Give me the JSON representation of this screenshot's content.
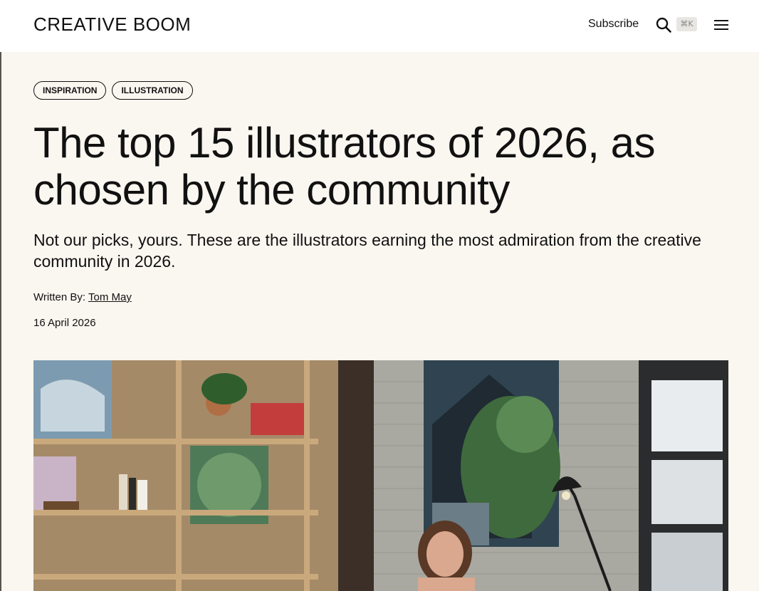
{
  "header": {
    "logo_text": "CREATIVE BOOM",
    "subscribe_label": "Subscribe",
    "search_shortcut": "⌘K"
  },
  "article": {
    "tags": [
      "INSPIRATION",
      "ILLUSTRATION"
    ],
    "title": "The top 15 illustrators of 2026, as chosen by the community",
    "subtitle": "Not our picks, yours. These are the illustrators earning the most admiration from the creative community in 2026.",
    "byline_prefix": "Written By: ",
    "author": "Tom May",
    "date": "16 April 2026"
  },
  "colors": {
    "page_background": "#faf6f0",
    "header_background": "#ffffff",
    "text": "#111111"
  },
  "icons": {
    "search": "search-icon",
    "menu": "hamburger-menu-icon"
  }
}
